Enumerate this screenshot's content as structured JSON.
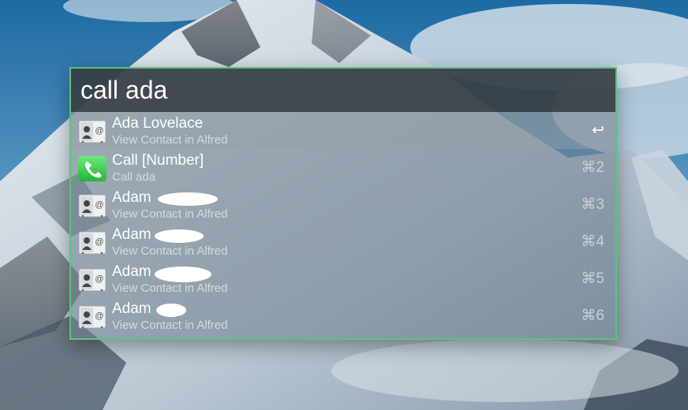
{
  "search": {
    "query": "call ada"
  },
  "results": [
    {
      "icon": "contact-card-icon",
      "title": "Ada Lovelace",
      "subtitle": "View Contact in Alfred",
      "shortcut": "↩",
      "selected": true
    },
    {
      "icon": "phone-icon",
      "title": "Call [Number]",
      "subtitle": "Call ada",
      "shortcut": "⌘2",
      "selected": false
    },
    {
      "icon": "contact-card-icon",
      "title": "Adam",
      "subtitle": "View Contact in Alfred",
      "shortcut": "⌘3",
      "selected": false
    },
    {
      "icon": "contact-card-icon",
      "title": "Adam",
      "subtitle": "View Contact in Alfred",
      "shortcut": "⌘4",
      "selected": false
    },
    {
      "icon": "contact-card-icon",
      "title": "Adam",
      "subtitle": "View Contact in Alfred",
      "shortcut": "⌘5",
      "selected": false
    },
    {
      "icon": "contact-card-icon",
      "title": "Adam",
      "subtitle": "View Contact in Alfred",
      "shortcut": "⌘6",
      "selected": false
    }
  ],
  "colors": {
    "window_border": "#5fc27a",
    "phone_icon_green": "#3fd35a"
  }
}
